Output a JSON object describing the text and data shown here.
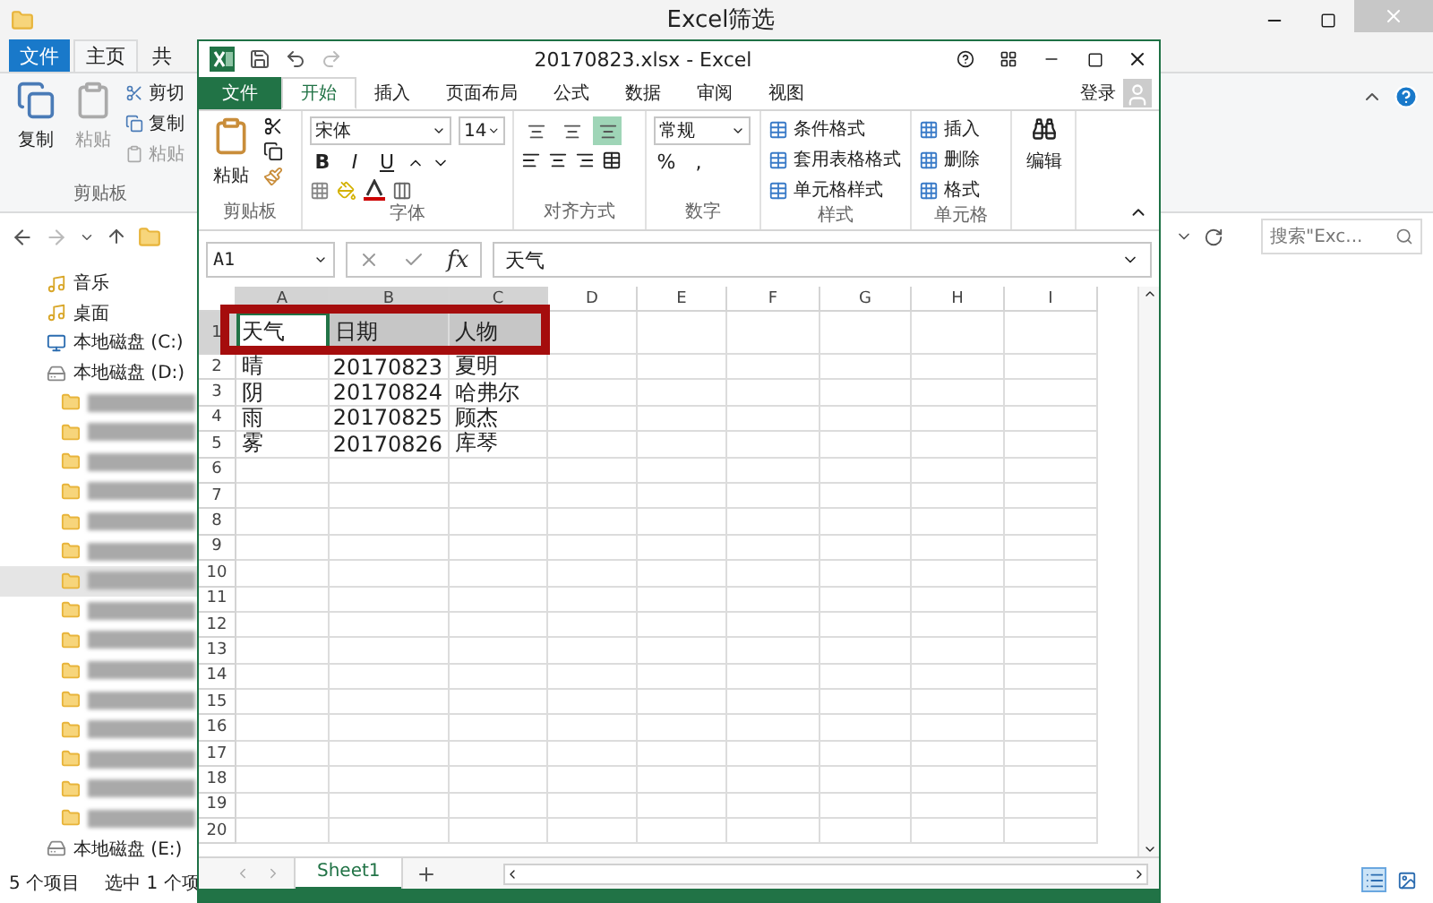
{
  "explorer": {
    "title": "Excel筛选",
    "tabs": [
      {
        "label": "文件",
        "kind": "file",
        "selected": false
      },
      {
        "label": "主页",
        "kind": "tab",
        "selected": true
      },
      {
        "label": "共",
        "kind": "tab",
        "selected": false
      }
    ],
    "ribbon": {
      "big_buttons": [
        {
          "label": "复制",
          "disabled": false
        },
        {
          "label": "粘贴",
          "disabled": true
        }
      ],
      "small_buttons": [
        {
          "label": "剪切",
          "disabled": false
        },
        {
          "label": "复制",
          "disabled": false
        },
        {
          "label": "粘贴",
          "disabled": true
        }
      ],
      "group_label": "剪贴板"
    },
    "search": {
      "placeholder": "搜索\"Exc..."
    },
    "nav": [
      {
        "kind": "library",
        "label": "音乐",
        "selected": false
      },
      {
        "kind": "library",
        "label": "桌面",
        "selected": false
      },
      {
        "kind": "system-drive",
        "label": "本地磁盘 (C:)",
        "selected": false
      },
      {
        "kind": "drive",
        "label": "本地磁盘 (D:)",
        "selected": false
      },
      {
        "kind": "blurred-folder",
        "selected": false
      },
      {
        "kind": "blurred-folder",
        "selected": false
      },
      {
        "kind": "blurred-folder",
        "selected": false
      },
      {
        "kind": "blurred-folder",
        "selected": false
      },
      {
        "kind": "blurred-folder",
        "selected": false
      },
      {
        "kind": "blurred-folder",
        "selected": false
      },
      {
        "kind": "blurred-folder",
        "selected": true
      },
      {
        "kind": "blurred-folder",
        "selected": false
      },
      {
        "kind": "blurred-folder",
        "selected": false
      },
      {
        "kind": "blurred-folder",
        "selected": false
      },
      {
        "kind": "blurred-folder",
        "selected": false
      },
      {
        "kind": "blurred-folder",
        "selected": false
      },
      {
        "kind": "blurred-folder",
        "selected": false
      },
      {
        "kind": "blurred-folder",
        "selected": false
      },
      {
        "kind": "blurred-folder",
        "selected": false
      },
      {
        "kind": "drive",
        "label": "本地磁盘 (E:)",
        "selected": false
      }
    ],
    "status": [
      "5 个项目",
      "选中 1 个项"
    ]
  },
  "excel": {
    "title": "20170823.xlsx - Excel",
    "tabs": [
      {
        "label": "文件",
        "kind": "file",
        "selected": false
      },
      {
        "label": "开始",
        "kind": "tab",
        "selected": true
      },
      {
        "label": "插入",
        "kind": "tab",
        "selected": false
      },
      {
        "label": "页面布局",
        "kind": "tab",
        "selected": false
      },
      {
        "label": "公式",
        "kind": "tab",
        "selected": false
      },
      {
        "label": "数据",
        "kind": "tab",
        "selected": false
      },
      {
        "label": "审阅",
        "kind": "tab",
        "selected": false
      },
      {
        "label": "视图",
        "kind": "tab",
        "selected": false
      }
    ],
    "sign_in": "登录",
    "ribbon": {
      "clipboard": {
        "paste": "粘贴",
        "label": "剪贴板"
      },
      "font": {
        "name": "宋体",
        "size": "14",
        "styles": [
          "B",
          "I",
          "U"
        ],
        "label": "字体"
      },
      "alignment": {
        "vertical": [
          {
            "selected": false
          },
          {
            "selected": false
          },
          {
            "selected": true
          }
        ],
        "label": "对齐方式"
      },
      "number": {
        "format": "常规",
        "symbols": [
          "%",
          ","
        ],
        "label": "数字"
      },
      "styles": {
        "items": [
          "条件格式",
          "套用表格格式",
          "单元格样式"
        ],
        "label": "样式"
      },
      "cells": {
        "items": [
          "插入",
          "删除",
          "格式"
        ],
        "label": "单元格"
      },
      "editing": {
        "label": "编辑"
      }
    },
    "name_box": "A1",
    "function_button": "fx",
    "formula": "天气",
    "columns": [
      {
        "label": "A",
        "selected": true
      },
      {
        "label": "B",
        "selected": true
      },
      {
        "label": "C",
        "selected": true
      },
      {
        "label": "D",
        "selected": false
      },
      {
        "label": "E",
        "selected": false
      },
      {
        "label": "F",
        "selected": false
      },
      {
        "label": "G",
        "selected": false
      },
      {
        "label": "H",
        "selected": false
      },
      {
        "label": "I",
        "selected": false
      }
    ],
    "rows": [
      {
        "number": "1",
        "selected": true,
        "cells": [
          "天气",
          "日期",
          "人物"
        ]
      },
      {
        "number": "2",
        "selected": false,
        "cells": [
          "晴",
          "20170823",
          "夏明"
        ]
      },
      {
        "number": "3",
        "selected": false,
        "cells": [
          "阴",
          "20170824",
          "哈弗尔"
        ]
      },
      {
        "number": "4",
        "selected": false,
        "cells": [
          "雨",
          "20170825",
          "顾杰"
        ]
      },
      {
        "number": "5",
        "selected": false,
        "cells": [
          "雾",
          "20170826",
          "库琴"
        ]
      },
      {
        "number": "6",
        "selected": false,
        "cells": []
      },
      {
        "number": "7",
        "selected": false,
        "cells": []
      },
      {
        "number": "8",
        "selected": false,
        "cells": []
      },
      {
        "number": "9",
        "selected": false,
        "cells": []
      },
      {
        "number": "10",
        "selected": false,
        "cells": []
      },
      {
        "number": "11",
        "selected": false,
        "cells": []
      },
      {
        "number": "12",
        "selected": false,
        "cells": []
      },
      {
        "number": "13",
        "selected": false,
        "cells": []
      },
      {
        "number": "14",
        "selected": false,
        "cells": []
      },
      {
        "number": "15",
        "selected": false,
        "cells": []
      },
      {
        "number": "16",
        "selected": false,
        "cells": []
      },
      {
        "number": "17",
        "selected": false,
        "cells": []
      },
      {
        "number": "18",
        "selected": false,
        "cells": []
      },
      {
        "number": "19",
        "selected": false,
        "cells": []
      },
      {
        "number": "20",
        "selected": false,
        "cells": []
      }
    ],
    "sheets": [
      {
        "label": "Sheet1",
        "selected": true
      }
    ]
  }
}
